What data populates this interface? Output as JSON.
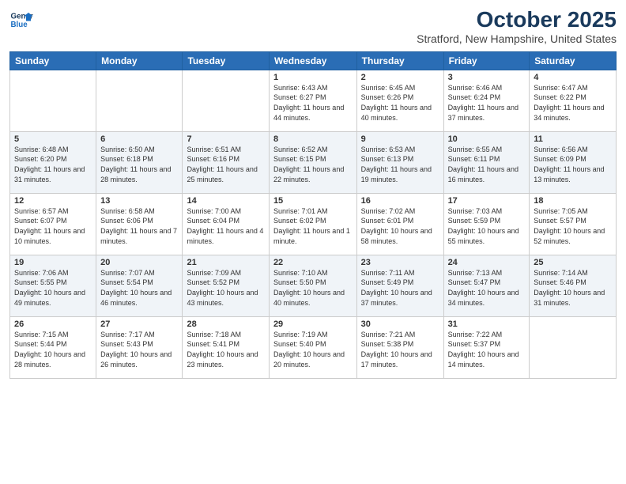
{
  "header": {
    "logo_line1": "General",
    "logo_line2": "Blue",
    "month": "October 2025",
    "location": "Stratford, New Hampshire, United States"
  },
  "weekdays": [
    "Sunday",
    "Monday",
    "Tuesday",
    "Wednesday",
    "Thursday",
    "Friday",
    "Saturday"
  ],
  "weeks": [
    [
      {
        "day": "",
        "info": ""
      },
      {
        "day": "",
        "info": ""
      },
      {
        "day": "",
        "info": ""
      },
      {
        "day": "1",
        "info": "Sunrise: 6:43 AM\nSunset: 6:27 PM\nDaylight: 11 hours and 44 minutes."
      },
      {
        "day": "2",
        "info": "Sunrise: 6:45 AM\nSunset: 6:26 PM\nDaylight: 11 hours and 40 minutes."
      },
      {
        "day": "3",
        "info": "Sunrise: 6:46 AM\nSunset: 6:24 PM\nDaylight: 11 hours and 37 minutes."
      },
      {
        "day": "4",
        "info": "Sunrise: 6:47 AM\nSunset: 6:22 PM\nDaylight: 11 hours and 34 minutes."
      }
    ],
    [
      {
        "day": "5",
        "info": "Sunrise: 6:48 AM\nSunset: 6:20 PM\nDaylight: 11 hours and 31 minutes."
      },
      {
        "day": "6",
        "info": "Sunrise: 6:50 AM\nSunset: 6:18 PM\nDaylight: 11 hours and 28 minutes."
      },
      {
        "day": "7",
        "info": "Sunrise: 6:51 AM\nSunset: 6:16 PM\nDaylight: 11 hours and 25 minutes."
      },
      {
        "day": "8",
        "info": "Sunrise: 6:52 AM\nSunset: 6:15 PM\nDaylight: 11 hours and 22 minutes."
      },
      {
        "day": "9",
        "info": "Sunrise: 6:53 AM\nSunset: 6:13 PM\nDaylight: 11 hours and 19 minutes."
      },
      {
        "day": "10",
        "info": "Sunrise: 6:55 AM\nSunset: 6:11 PM\nDaylight: 11 hours and 16 minutes."
      },
      {
        "day": "11",
        "info": "Sunrise: 6:56 AM\nSunset: 6:09 PM\nDaylight: 11 hours and 13 minutes."
      }
    ],
    [
      {
        "day": "12",
        "info": "Sunrise: 6:57 AM\nSunset: 6:07 PM\nDaylight: 11 hours and 10 minutes."
      },
      {
        "day": "13",
        "info": "Sunrise: 6:58 AM\nSunset: 6:06 PM\nDaylight: 11 hours and 7 minutes."
      },
      {
        "day": "14",
        "info": "Sunrise: 7:00 AM\nSunset: 6:04 PM\nDaylight: 11 hours and 4 minutes."
      },
      {
        "day": "15",
        "info": "Sunrise: 7:01 AM\nSunset: 6:02 PM\nDaylight: 11 hours and 1 minute."
      },
      {
        "day": "16",
        "info": "Sunrise: 7:02 AM\nSunset: 6:01 PM\nDaylight: 10 hours and 58 minutes."
      },
      {
        "day": "17",
        "info": "Sunrise: 7:03 AM\nSunset: 5:59 PM\nDaylight: 10 hours and 55 minutes."
      },
      {
        "day": "18",
        "info": "Sunrise: 7:05 AM\nSunset: 5:57 PM\nDaylight: 10 hours and 52 minutes."
      }
    ],
    [
      {
        "day": "19",
        "info": "Sunrise: 7:06 AM\nSunset: 5:55 PM\nDaylight: 10 hours and 49 minutes."
      },
      {
        "day": "20",
        "info": "Sunrise: 7:07 AM\nSunset: 5:54 PM\nDaylight: 10 hours and 46 minutes."
      },
      {
        "day": "21",
        "info": "Sunrise: 7:09 AM\nSunset: 5:52 PM\nDaylight: 10 hours and 43 minutes."
      },
      {
        "day": "22",
        "info": "Sunrise: 7:10 AM\nSunset: 5:50 PM\nDaylight: 10 hours and 40 minutes."
      },
      {
        "day": "23",
        "info": "Sunrise: 7:11 AM\nSunset: 5:49 PM\nDaylight: 10 hours and 37 minutes."
      },
      {
        "day": "24",
        "info": "Sunrise: 7:13 AM\nSunset: 5:47 PM\nDaylight: 10 hours and 34 minutes."
      },
      {
        "day": "25",
        "info": "Sunrise: 7:14 AM\nSunset: 5:46 PM\nDaylight: 10 hours and 31 minutes."
      }
    ],
    [
      {
        "day": "26",
        "info": "Sunrise: 7:15 AM\nSunset: 5:44 PM\nDaylight: 10 hours and 28 minutes."
      },
      {
        "day": "27",
        "info": "Sunrise: 7:17 AM\nSunset: 5:43 PM\nDaylight: 10 hours and 26 minutes."
      },
      {
        "day": "28",
        "info": "Sunrise: 7:18 AM\nSunset: 5:41 PM\nDaylight: 10 hours and 23 minutes."
      },
      {
        "day": "29",
        "info": "Sunrise: 7:19 AM\nSunset: 5:40 PM\nDaylight: 10 hours and 20 minutes."
      },
      {
        "day": "30",
        "info": "Sunrise: 7:21 AM\nSunset: 5:38 PM\nDaylight: 10 hours and 17 minutes."
      },
      {
        "day": "31",
        "info": "Sunrise: 7:22 AM\nSunset: 5:37 PM\nDaylight: 10 hours and 14 minutes."
      },
      {
        "day": "",
        "info": ""
      }
    ]
  ]
}
